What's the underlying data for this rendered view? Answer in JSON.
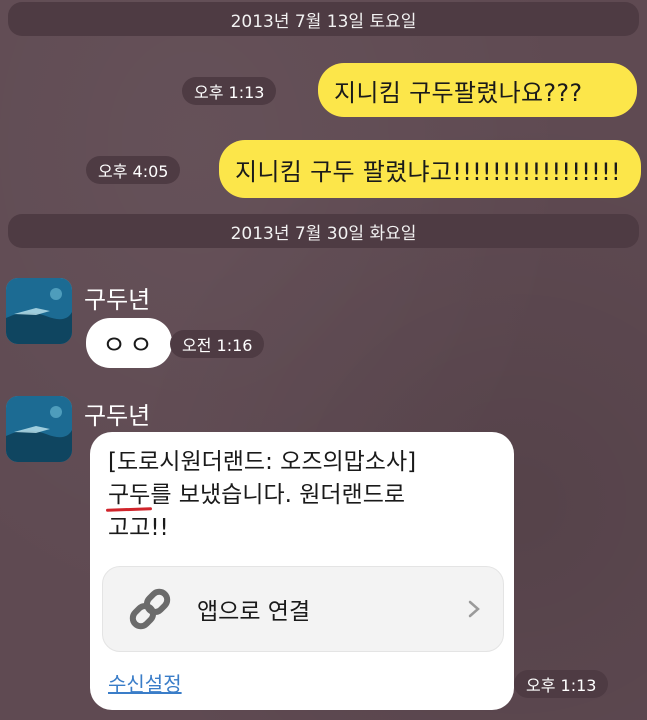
{
  "dates": {
    "first": "2013년 7월 13일 토요일",
    "second": "2013년 7월 30일 화요일"
  },
  "messages_out": [
    {
      "time": "오후 1:13",
      "text": "지니킴 구두팔렸나요???"
    },
    {
      "time": "오후 4:05",
      "text": "지니킴 구두 팔렸냐고!!!!!!!!!!!!!!!!!"
    }
  ],
  "messages_in": [
    {
      "sender": "구두년",
      "text": "ㅇㅇ",
      "time": "오전 1:16"
    }
  ],
  "card_message": {
    "sender": "구두년",
    "line1": "[도로시원더랜드: 오즈의맙소사]",
    "line2_word": "구두",
    "line2_rest": "를 보냈습니다. 원더랜드로",
    "line3": "고고!!",
    "link_label": "앱으로 연결",
    "settings_label": "수신설정",
    "time": "오후 1:13"
  },
  "colors": {
    "background": "#5f4a52",
    "bubble_out": "#fce64a",
    "bubble_in": "#ffffff",
    "link": "#3a7dc8",
    "annotation": "#d0242b"
  },
  "icons": {
    "link_icon": "chain-link-icon",
    "chevron": "chevron-right-icon"
  }
}
